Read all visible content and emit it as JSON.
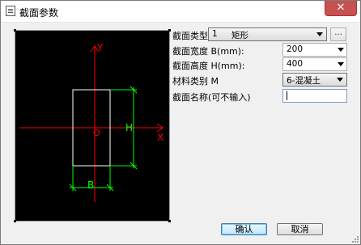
{
  "window": {
    "title": "截面参数",
    "close_glyph": "✕"
  },
  "preview": {
    "axis_y_label": "Y",
    "axis_x_label": "X",
    "origin_label": "O",
    "height_dim_label": "H",
    "width_dim_label": "B"
  },
  "form": {
    "section_type": {
      "label": "截面类型",
      "value_index": "1",
      "value_name": "矩形",
      "more_button": "..."
    },
    "width": {
      "label": "截面宽度 B(mm):",
      "value": "200"
    },
    "height": {
      "label": "截面高度 H(mm):",
      "value": "400"
    },
    "material": {
      "label": "材料类别 M",
      "value": "6-混凝土"
    },
    "name": {
      "label": "截面名称(可不输入)",
      "value": ""
    }
  },
  "buttons": {
    "ok": "确认",
    "cancel": "取消"
  },
  "colors": {
    "axis": "#ff0000",
    "dimension": "#00ff00",
    "outline": "#ffffff",
    "background": "#000000"
  }
}
